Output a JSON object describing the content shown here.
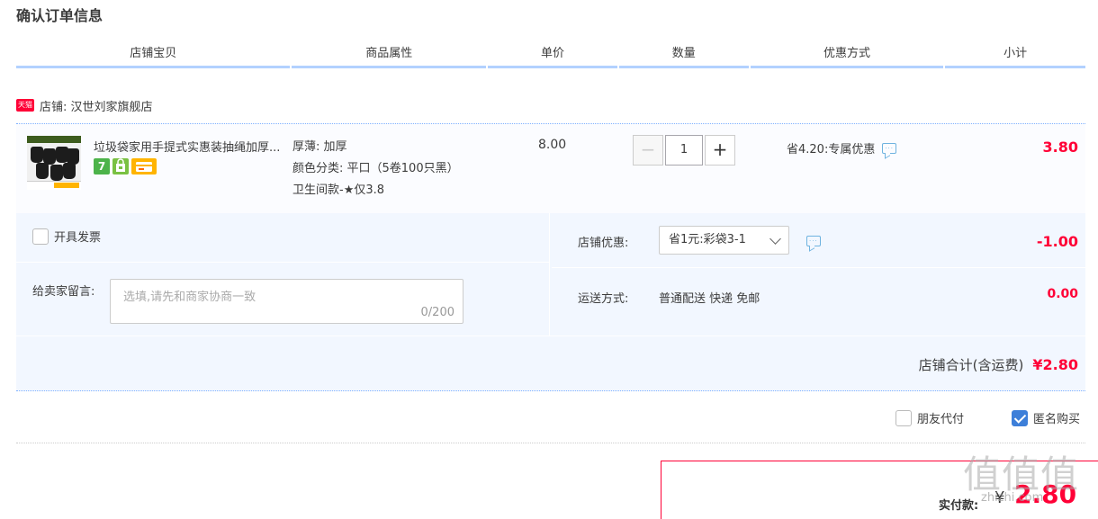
{
  "page_title": "确认订单信息",
  "columns": [
    {
      "label": "店铺宝贝",
      "width": 305
    },
    {
      "label": "商品属性",
      "width": 216
    },
    {
      "label": "单价",
      "width": 144
    },
    {
      "label": "数量",
      "width": 144
    },
    {
      "label": "优惠方式",
      "width": 215
    },
    {
      "label": "小计",
      "width": 156
    }
  ],
  "shop": {
    "badge": "天猫",
    "label": "店铺: 汉世刘家旗舰店"
  },
  "item": {
    "title": "垃圾袋家用手提式实惠装抽绳加厚...",
    "props": [
      "厚薄: 加厚",
      "颜色分类: 平口（5卷100只黑）",
      "卫生间款-★仅3.8"
    ],
    "price": "8.00",
    "qty_minus": "−",
    "qty_value": "1",
    "qty_plus": "+",
    "promo": "省4.20:专属优惠",
    "subtotal": "3.80",
    "service_icons": [
      "seven-day-return-icon",
      "shopping-bag-icon",
      "card-payment-icon"
    ],
    "service_seven": "7"
  },
  "options": {
    "invoice_label": "开具发票",
    "memo_label": "给卖家留言:",
    "memo_placeholder": "选填,请先和商家协商一致",
    "memo_count": "0/200",
    "shop_discount_label": "店铺优惠:",
    "shop_discount_value": "省1元:彩袋3-1",
    "shop_discount_amount": "-1.00",
    "shipping_label": "运送方式:",
    "shipping_value": "普通配送 快递 免邮",
    "shipping_amount": "0.00",
    "shop_total_label": "店铺合计(含运费)",
    "shop_total_amount": "¥2.80"
  },
  "pay_options": {
    "friend_pay": "朋友代付",
    "anonymous": "匿名购买",
    "friend_pay_checked": false,
    "anonymous_checked": true
  },
  "payment": {
    "label": "实付款:",
    "currency": "¥",
    "amount": "2.80"
  },
  "watermark": {
    "big": "值值值",
    "small": "zhizhi.com"
  },
  "colors": {
    "accent": "#ff0036",
    "header_line": "#b2d1ff",
    "panel_bg": "#f2f7ff",
    "checkbox": "#3d7fd9"
  }
}
